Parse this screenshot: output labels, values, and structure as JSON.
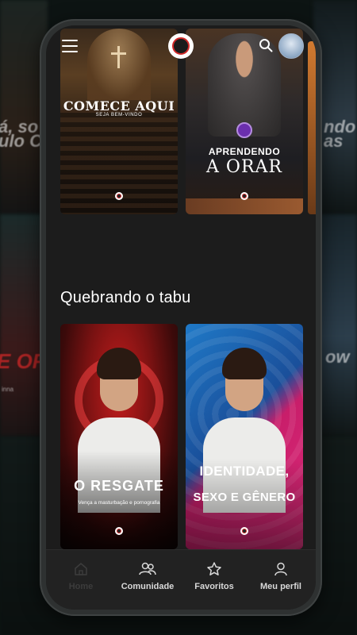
{
  "background": {
    "left_text": [
      "á, so",
      "ulo C"
    ],
    "left_red_text": "E OF",
    "left_small_text": "inna",
    "right_text": [
      "ndo",
      "as"
    ],
    "right_mid_text": "ow"
  },
  "header": {
    "menu_icon": "hamburger-menu-icon",
    "logo_icon": "brand-logo-icon",
    "search_icon": "search-icon",
    "avatar_icon": "user-avatar-icon"
  },
  "featured": [
    {
      "title": "COMECE AQUI",
      "subtitle": "SEJA BEM-VINDO"
    },
    {
      "title_top": "APRENDENDO",
      "title_bottom": "A ORAR"
    }
  ],
  "section": {
    "title": "Quebrando o tabu",
    "cards": [
      {
        "title": "O RESGATE",
        "subtitle": "Vença a masturbação e pornografia"
      },
      {
        "title_top": "IDENTIDADE,",
        "title_bottom": "SEXO E GÊNERO"
      }
    ]
  },
  "nav": {
    "items": [
      {
        "label": "Home",
        "icon": "home-icon"
      },
      {
        "label": "Comunidade",
        "icon": "community-icon"
      },
      {
        "label": "Favoritos",
        "icon": "star-icon"
      },
      {
        "label": "Meu perfil",
        "icon": "profile-icon"
      }
    ]
  },
  "colors": {
    "screen_bg": "#1c1c1c",
    "nav_bg": "#222222",
    "brand_red": "#d12a2a"
  }
}
